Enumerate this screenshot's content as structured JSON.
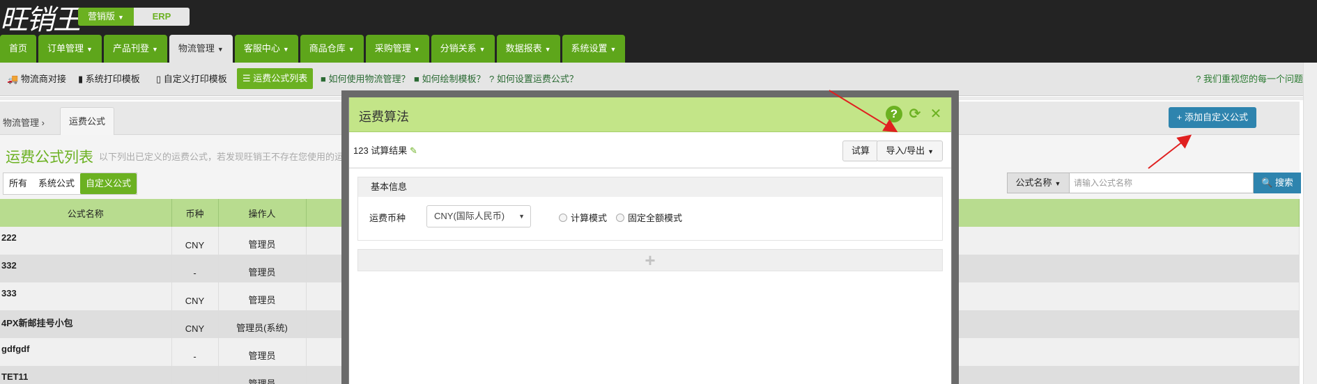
{
  "brand": {
    "logo_text": "旺销王",
    "edition_label": "营销版",
    "erp_label": "ERP"
  },
  "nav": {
    "tabs": [
      "首页",
      "订单管理",
      "产品刊登",
      "物流管理",
      "客服中心",
      "商品仓库",
      "采购管理",
      "分销关系",
      "数据报表",
      "系统设置"
    ]
  },
  "subnav": {
    "links": [
      "物流商对接",
      "系统打印模板",
      "自定义打印模板",
      "运费公式列表"
    ],
    "help": [
      "如何使用物流管理？",
      "如何绘制模板？",
      "如何设置运费公式？"
    ],
    "tip": "我们重视您的每一个问题"
  },
  "breadcrumb": {
    "parent": "物流管理",
    "current": "运费公式"
  },
  "toolbar": {
    "add_label": "添加自定义公式"
  },
  "page": {
    "title": "运费公式列表",
    "desc": "以下列出已定义的运费公式，若发现旺销王不存在您使用的运"
  },
  "filters": {
    "all": "所有",
    "system": "系统公式",
    "custom": "自定义公式"
  },
  "search": {
    "select_label": "公式名称",
    "placeholder": "请输入公式名称",
    "button_label": "搜索"
  },
  "table": {
    "headers": [
      "公式名称",
      "币种",
      "操作人"
    ],
    "rows": [
      {
        "name": "222",
        "currency": "CNY",
        "operator": "管理员"
      },
      {
        "name": "332",
        "currency": "-",
        "operator": "管理员"
      },
      {
        "name": "333",
        "currency": "CNY",
        "operator": "管理员"
      },
      {
        "name": "4PX新邮挂号小包",
        "currency": "CNY",
        "operator": "管理员(系统)"
      },
      {
        "name": "gdfgdf",
        "currency": "-",
        "operator": "管理员"
      },
      {
        "name": "TET11",
        "currency": "-",
        "operator": "管理员"
      }
    ]
  },
  "dialog": {
    "title": "运费算法",
    "result_label": "123 试算结果",
    "trial_label": "试算",
    "import_export_label": "导入/导出",
    "section_title": "基本信息",
    "currency_label": "运费币种",
    "currency_value": "CNY(国际人民币)",
    "mode_calc": "计算模式",
    "mode_fixed": "固定全额模式",
    "add_symbol": "+"
  },
  "colors": {
    "accent": "#6bb121",
    "topbar": "#232323",
    "button_blue": "#2e84ae",
    "dialog_header": "#c3e588"
  }
}
